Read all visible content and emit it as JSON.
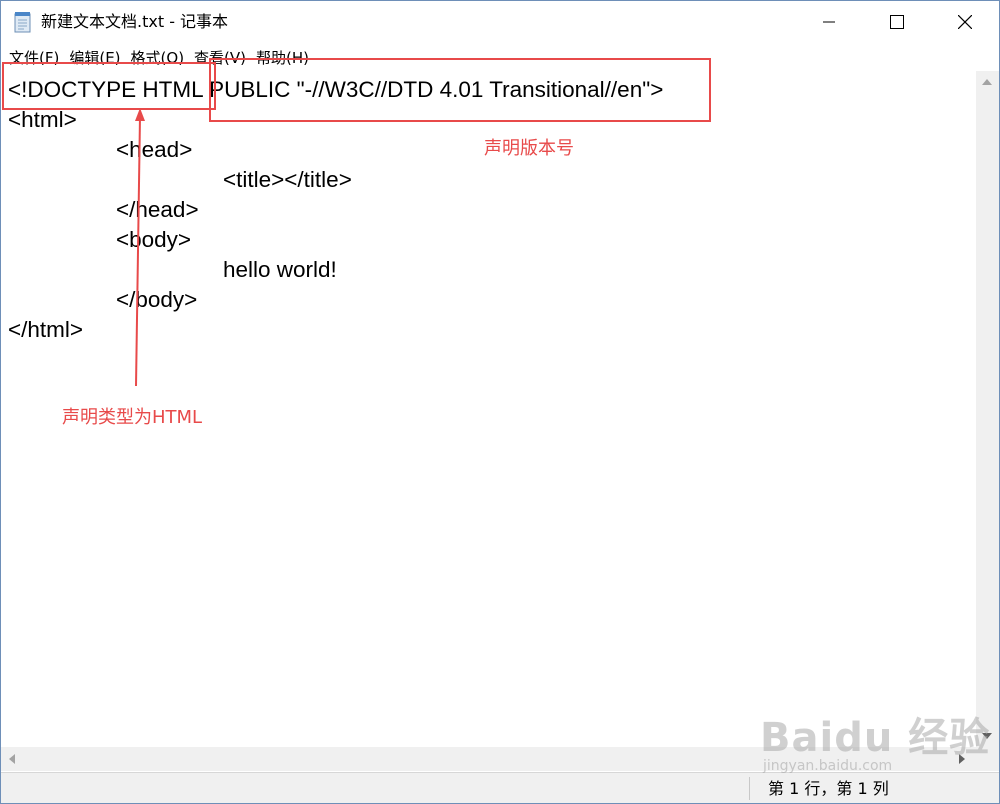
{
  "window": {
    "title": "新建文本文档.txt - 记事本"
  },
  "menu": [
    "文件(F)",
    "编辑(E)",
    "格式(O)",
    "查看(V)",
    "帮助(H)"
  ],
  "editor": {
    "lines": [
      "<!DOCTYPE HTML PUBLIC \"-//W3C//DTD 4.01 Transitional//en\">",
      "<html>",
      "<head>",
      "<title></title>",
      "</head>",
      "<body>",
      "hello world!",
      "</body>",
      "</html>"
    ]
  },
  "status": {
    "position": "第 1 行，第 1 列"
  },
  "annotations": {
    "version_label": "声明版本号",
    "type_label": "声明类型为HTML",
    "color": "#e84a4a"
  },
  "watermark": {
    "logo": "Baidu 经验",
    "url": "jingyan.baidu.com"
  }
}
